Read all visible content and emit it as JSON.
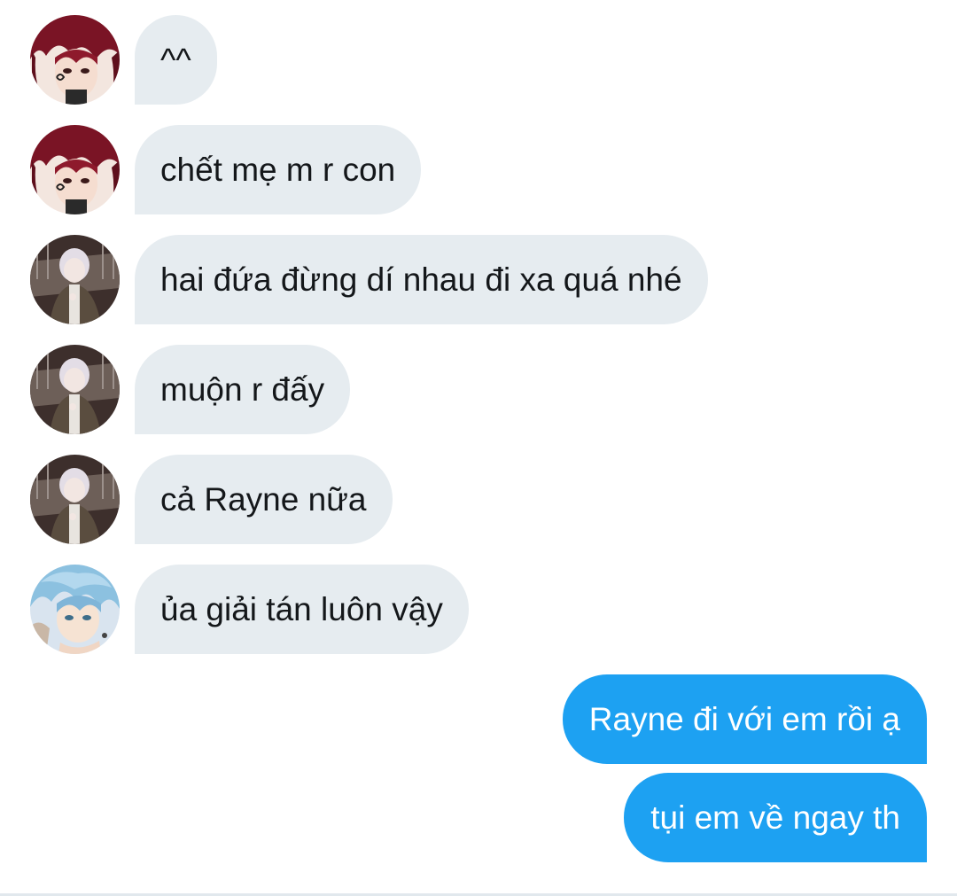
{
  "conversation": {
    "messages": [
      {
        "direction": "received",
        "avatar": "avatar-red-hair",
        "text": "^^"
      },
      {
        "direction": "received",
        "avatar": "avatar-red-hair",
        "text": "chết mẹ m r con"
      },
      {
        "direction": "received",
        "avatar": "avatar-silver-hair",
        "text": "hai đứa đừng dí nhau đi xa quá nhé"
      },
      {
        "direction": "received",
        "avatar": "avatar-silver-hair",
        "text": "muộn r đấy"
      },
      {
        "direction": "received",
        "avatar": "avatar-silver-hair",
        "text": "cả Rayne nữa"
      },
      {
        "direction": "received",
        "avatar": "avatar-blue-hair",
        "text": "ủa giải tán luôn vậy"
      },
      {
        "direction": "sent",
        "text": "Rayne đi với em rồi ạ"
      },
      {
        "direction": "sent",
        "text": "tụi em về ngay th"
      }
    ]
  },
  "colors": {
    "received_bubble": "#e6ecf0",
    "sent_bubble": "#1da1f2",
    "received_text": "#14171a",
    "sent_text": "#ffffff"
  }
}
